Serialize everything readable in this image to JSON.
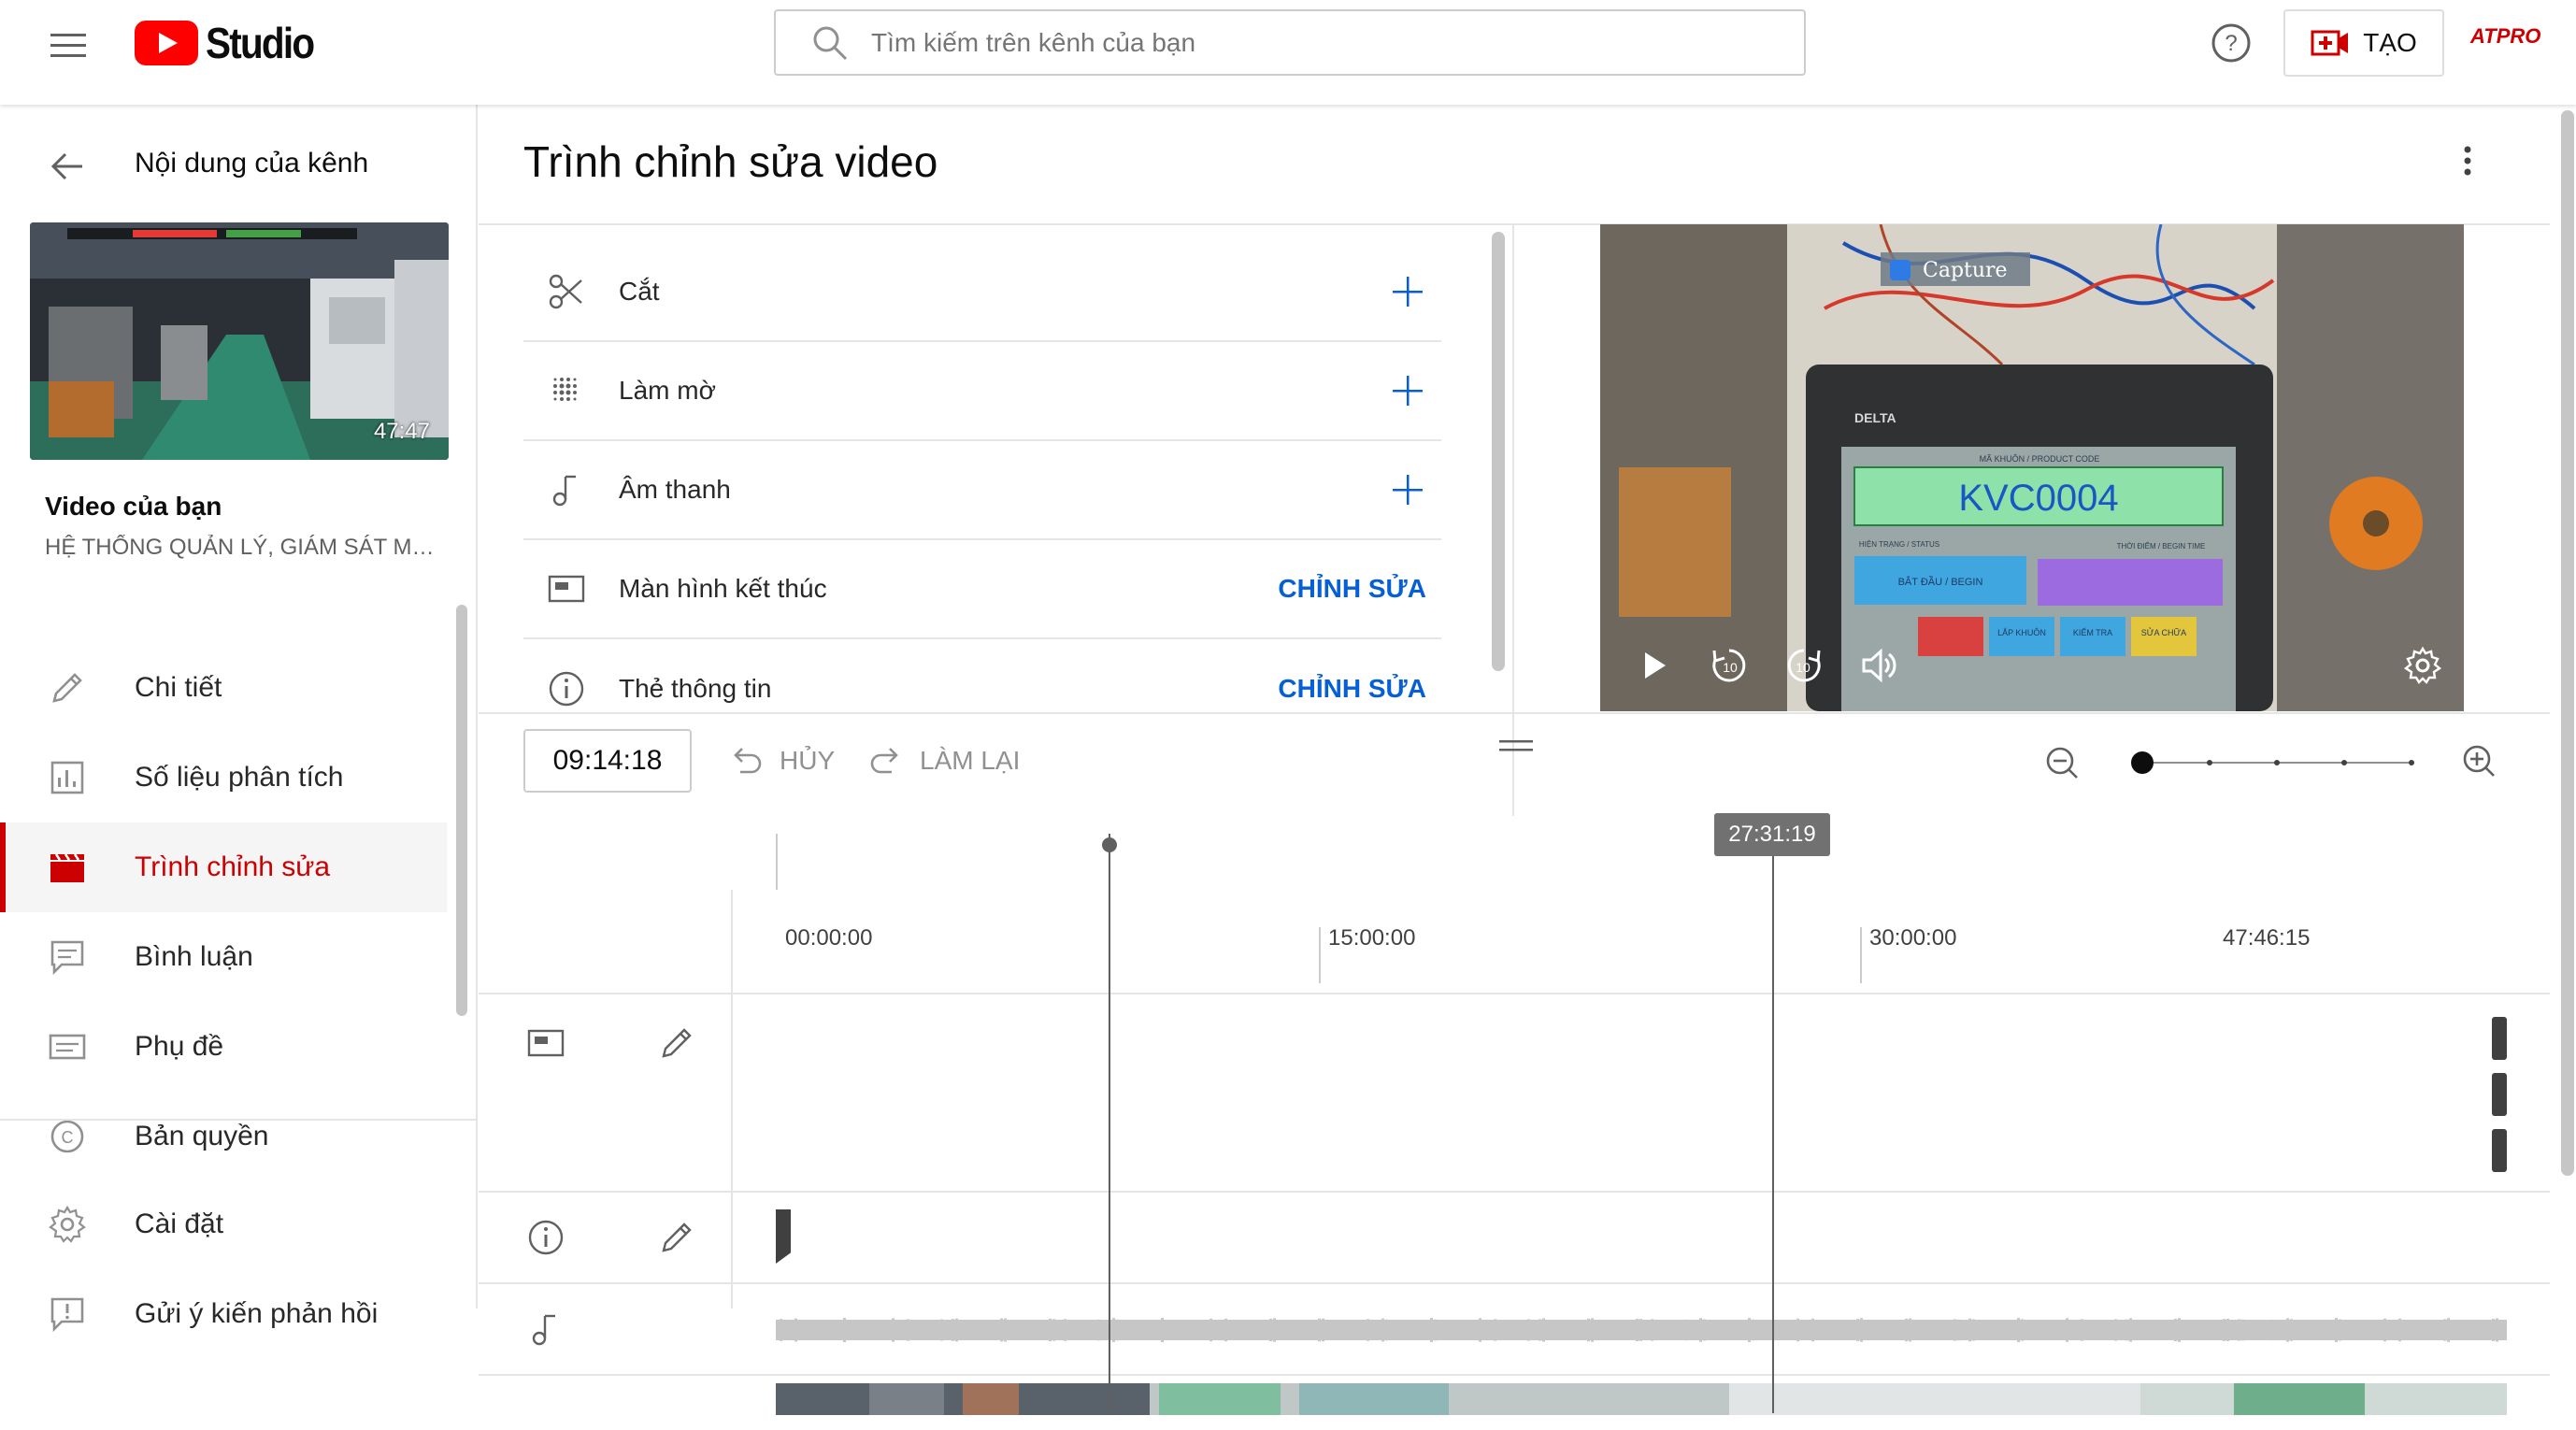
{
  "header": {
    "app_name": "Studio",
    "search_placeholder": "Tìm kiếm trên kênh của bạn",
    "create_label": "TẠO",
    "avatar_text": "ATPRO"
  },
  "sidebar": {
    "back_title": "Nội dung của kênh",
    "thumbnail_duration": "47:47",
    "video_label": "Video của bạn",
    "video_title": "HỆ THỐNG QUẢN LÝ, GIÁM SÁT MÁ...",
    "items": [
      {
        "label": "Chi tiết",
        "icon": "pencil-icon"
      },
      {
        "label": "Số liệu phân tích",
        "icon": "analytics-icon"
      },
      {
        "label": "Trình chỉnh sửa",
        "icon": "clapperboard-icon",
        "active": true
      },
      {
        "label": "Bình luận",
        "icon": "comment-icon"
      },
      {
        "label": "Phụ đề",
        "icon": "subtitles-icon"
      },
      {
        "label": "Bản quyền",
        "icon": "copyright-icon"
      }
    ],
    "bottom_items": [
      {
        "label": "Cài đặt",
        "icon": "gear-icon"
      },
      {
        "label": "Gửi ý kiến phản hồi",
        "icon": "feedback-icon"
      }
    ]
  },
  "editor": {
    "title": "Trình chỉnh sửa video",
    "tools": [
      {
        "label": "Cắt",
        "icon": "scissors-icon",
        "action": "+"
      },
      {
        "label": "Làm mờ",
        "icon": "blur-icon",
        "action": "+"
      },
      {
        "label": "Âm thanh",
        "icon": "music-note-icon",
        "action": "+"
      },
      {
        "label": "Màn hình kết thúc",
        "icon": "end-screen-icon",
        "action": "CHỈNH SỬA"
      },
      {
        "label": "Thẻ thông tin",
        "icon": "info-icon",
        "action": "CHỈNH SỬA"
      }
    ],
    "preview": {
      "capture_label": "Capture",
      "screen_brand": "DELTA",
      "screen_code": "KVC0004",
      "screen_header": "MÃ KHUÔN / PRODUCT CODE",
      "screen_status": "HIỆN TRẠNG / STATUS",
      "screen_time": "THỜI ĐIỂM / BEGIN TIME",
      "screen_button_1": "BẮT ĐẦU / BEGIN",
      "screen_button_2": "LẮP KHUÔN",
      "screen_button_3": "KIỂM TRA",
      "screen_button_4": "SỬA CHỮA",
      "skip_back": "10",
      "skip_forward": "10"
    },
    "time_display": "09:14:18",
    "undo_label": "HỦY",
    "redo_label": "LÀM LẠI",
    "ruler_ticks": [
      "00:00:00",
      "15:00:00",
      "30:00:00",
      "47:46:15"
    ],
    "playhead_time": "27:31:19",
    "zoom_level": 0
  }
}
